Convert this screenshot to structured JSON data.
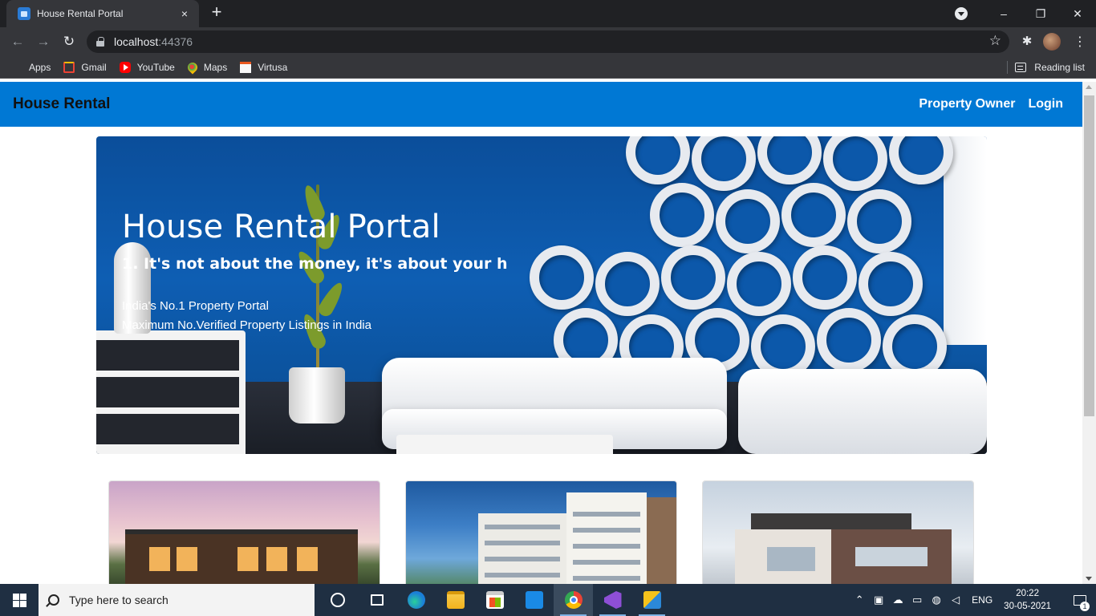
{
  "browser": {
    "tab": {
      "title": "House Rental Portal",
      "close_icon": "×"
    },
    "new_tab_icon": "+",
    "window_controls": {
      "minimize": "–",
      "restore": "❐",
      "close": "✕"
    },
    "nav": {
      "back": "←",
      "forward": "→",
      "reload": "↻"
    },
    "url": {
      "host": "localhost",
      "port": ":44376"
    },
    "star_icon": "☆",
    "extensions_icon": "✱",
    "menu_icon": "⋮",
    "bookmarks": [
      {
        "label": "Apps",
        "icon": "apps-icon"
      },
      {
        "label": "Gmail",
        "icon": "gmail-icon"
      },
      {
        "label": "YouTube",
        "icon": "youtube-icon"
      },
      {
        "label": "Maps",
        "icon": "maps-icon"
      },
      {
        "label": "Virtusa",
        "icon": "virtusa-icon"
      }
    ],
    "reading_list": "Reading list"
  },
  "site": {
    "brand": "House Rental",
    "nav_links": [
      {
        "label": "Property Owner"
      },
      {
        "label": "Login"
      }
    ],
    "hero": {
      "title": "House Rental Portal",
      "tagline": "1. It's not about the money, it's about your h",
      "subtitle_lines": [
        "India's No.1 Property Portal",
        "Maximum No.Verified Property Listings in India"
      ]
    },
    "colors": {
      "navbar": "#0078d4",
      "hero_wall": "#0e5eb3"
    }
  },
  "taskbar": {
    "search_placeholder": "Type here to search",
    "apps": [
      "cortana",
      "task-view",
      "edge",
      "file-explorer",
      "store",
      "mail",
      "chrome",
      "visual-studio",
      "app"
    ],
    "tray": {
      "language": "ENG",
      "time": "20:22",
      "date": "30-05-2021",
      "notification_count": "1"
    }
  }
}
